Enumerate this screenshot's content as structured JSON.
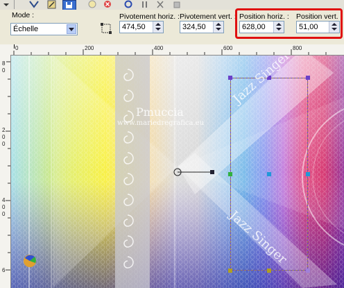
{
  "options": {
    "mode_label": "Mode :",
    "mode_value": "Échelle",
    "pivot_h_label": "Pivotement horiz. :",
    "pivot_h_value": "474,50",
    "pivot_v_label": "Pivotement vert. :",
    "pivot_v_value": "324,50",
    "pos_h_label": "Position horiz. :",
    "pos_h_value": "628,00",
    "pos_v_label": "Position vert. :",
    "pos_v_value": "51,00"
  },
  "rulers": {
    "h_labels": [
      "0",
      "200",
      "400",
      "600",
      "800"
    ],
    "v_labels": [
      "8",
      "0",
      "2",
      "0",
      "0",
      "4",
      "0",
      "0",
      "6"
    ]
  },
  "canvas": {
    "watermark_name": "Pmuccia",
    "watermark_url": "www.mariedregrafica.eu",
    "banner_text_1": "Jazz Singer",
    "banner_text_2": "Jazz Singer"
  },
  "colors": {
    "highlight": "#e01010",
    "selection": "#6a40c8",
    "ui_panel": "#ece9d8"
  }
}
